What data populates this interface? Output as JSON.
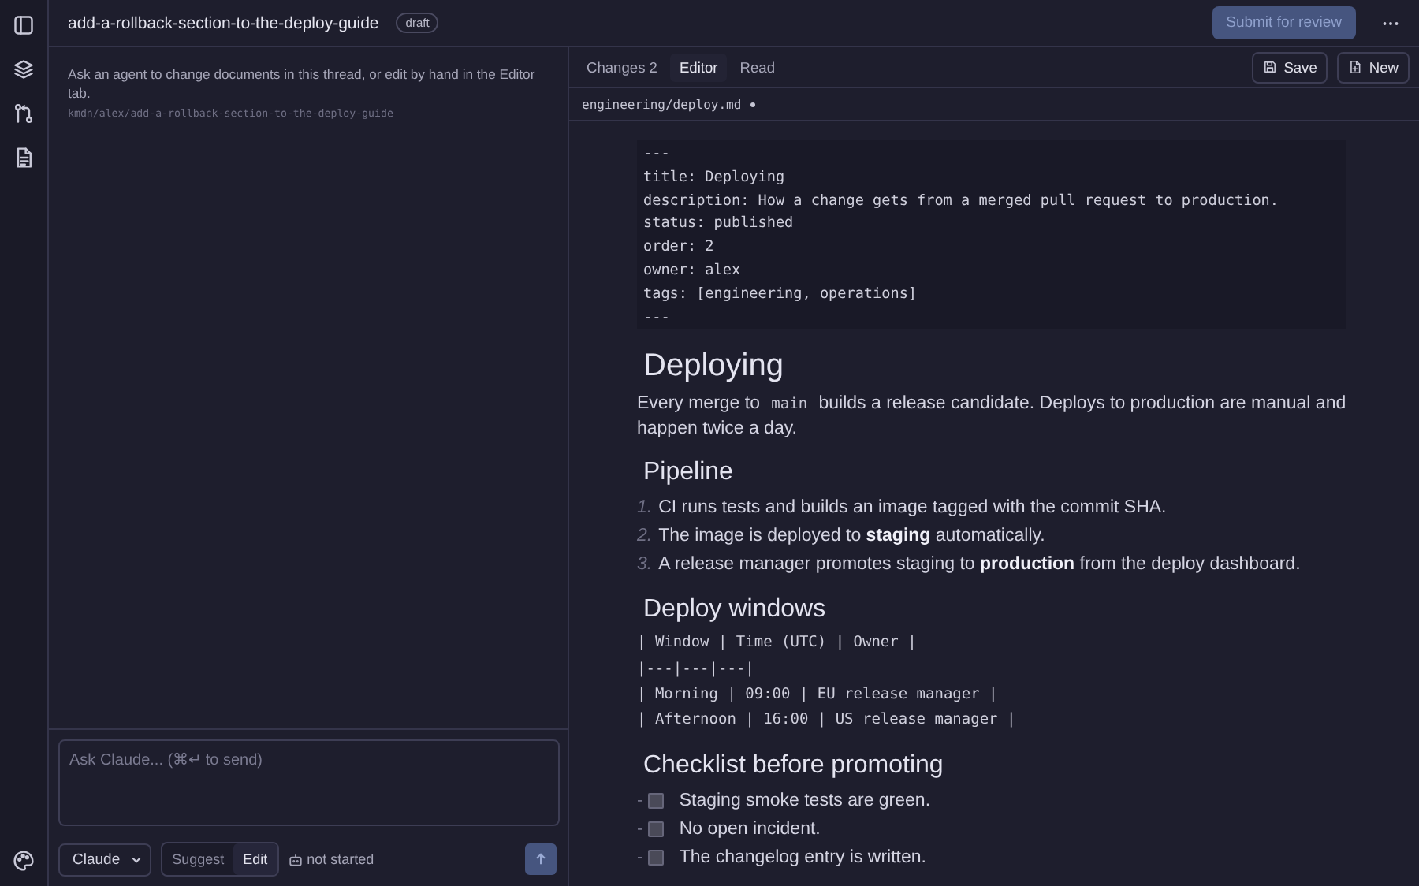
{
  "thread": {
    "title": "add-a-rollback-section-to-the-deploy-guide",
    "status": "draft",
    "intro": "Ask an agent to change documents in this thread, or edit by hand in the Editor tab.",
    "branch": "kmdn/alex/add-a-rollback-section-to-the-deploy-guide",
    "submit": "Submit for review"
  },
  "composer": {
    "placeholder": "Ask Claude... (⌘↵ to send)",
    "model": "Claude",
    "modes": [
      {
        "label": "Suggest",
        "selected": false
      },
      {
        "label": "Edit",
        "selected": true
      }
    ],
    "agent_status": "not started"
  },
  "editor": {
    "tabs": [
      {
        "label": "Changes",
        "count": "2",
        "selected": false
      },
      {
        "label": "Editor",
        "selected": true
      },
      {
        "label": "Read",
        "selected": false
      }
    ],
    "buttons": [
      {
        "kind": "save",
        "label": "Save"
      },
      {
        "kind": "new",
        "label": "New"
      }
    ],
    "file": {
      "path": "engineering/deploy.md",
      "unsaved": true
    },
    "frontmatter": [
      "---",
      "title: Deploying",
      "description: How a change gets from a merged pull request to production.",
      "status: published",
      "order: 2",
      "owner: alex",
      "tags: [engineering, operations]",
      "---"
    ],
    "blocks": [
      {
        "kind": "h1",
        "text": "Deploying"
      },
      {
        "kind": "paragraph",
        "parts": [
          {
            "kind": "text",
            "text": "Every merge to "
          },
          {
            "kind": "code",
            "text": "main"
          },
          {
            "kind": "text",
            "text": " builds a release candidate. Deploys to production are manual and happen twice a day."
          }
        ]
      },
      {
        "kind": "h2",
        "text": "Pipeline"
      },
      {
        "kind": "ordered_list",
        "items": [
          {
            "number": "1.",
            "text": "CI runs tests and builds an image tagged with the commit SHA."
          },
          {
            "number": "2.",
            "text": "The image is deployed to **staging** automatically."
          },
          {
            "number": "3.",
            "text": "A release manager promotes staging to **production** from the deploy dashboard."
          }
        ]
      },
      {
        "kind": "h2",
        "text": "Deploy windows"
      },
      {
        "kind": "source_table",
        "lines": [
          "| Window | Time (UTC) | Owner |",
          "|---|---|---|",
          "| Morning | 09:00 | EU release manager |",
          "| Afternoon | 16:00 | US release manager |"
        ]
      },
      {
        "kind": "h2",
        "text": "Checklist before promoting"
      },
      {
        "kind": "checklist",
        "items": [
          {
            "bullet": "-",
            "text": "Staging smoke tests are green.",
            "checked": false
          },
          {
            "bullet": "-",
            "text": "No open incident.",
            "checked": false
          },
          {
            "bullet": "-",
            "text": "The changelog entry is written.",
            "checked": false
          }
        ]
      }
    ]
  }
}
